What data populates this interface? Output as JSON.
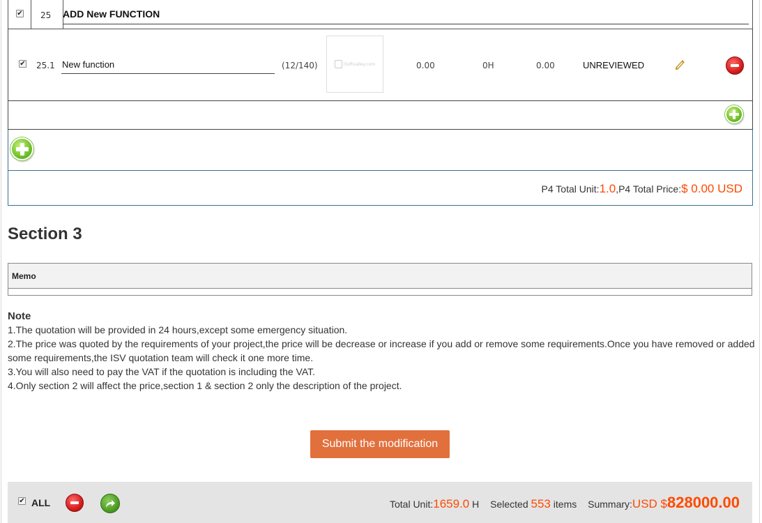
{
  "group": {
    "number": "25",
    "title": "ADD New FUNCTION",
    "checked": true
  },
  "item": {
    "number": "25.1",
    "name": "New function",
    "char_count": "(12/140)",
    "thumbnail_text": "iSoftvalley.com",
    "price": "0.00",
    "hours": "0H",
    "total": "0.00",
    "status": "UNREVIEWED",
    "checked": true,
    "icons": {
      "edit": "pencil-icon",
      "remove": "minus-circle-icon",
      "add": "plus-circle-icon"
    }
  },
  "p4_totals": {
    "unit_label": "P4 Total Unit:",
    "unit_value": "1.0",
    "price_label": ",P4 Total Price:",
    "price_value": "$ 0.00 USD"
  },
  "section3": {
    "title": "Section 3",
    "memo_header": "Memo",
    "memo_value": ""
  },
  "note": {
    "title": "Note",
    "lines": [
      "1.The quotation will be provided in 24 hours,except some emergency situation.",
      "2.The price was quoted by the requirements of your project,the price will be decrease or increase if you add or remove some requirements.Once you have removed or added",
      "some requirements,the ISV quotation team will check it one more time.",
      "3.You will also need to pay the VAT if the quotation is including the VAT.",
      "4.Only section 2 will affect the price,section 1 & section 2 only the description of the project."
    ]
  },
  "submit_label": "Submit the modification",
  "footer": {
    "all_label": "ALL",
    "all_checked": true,
    "total_unit_label": "Total Unit:",
    "total_unit_value": "1659.0",
    "unit_suffix": "H",
    "selected_label": "Selected",
    "selected_value": "553",
    "items_label": "items",
    "summary_label": "Summary:",
    "summary_currency": "USD $",
    "summary_value": "828000.00"
  },
  "colors": {
    "accent_orange": "#ff4a00",
    "submit_button": "#e2703d",
    "border_blue": "#3a6f8f",
    "footer_bg": "#e4e4e4"
  }
}
